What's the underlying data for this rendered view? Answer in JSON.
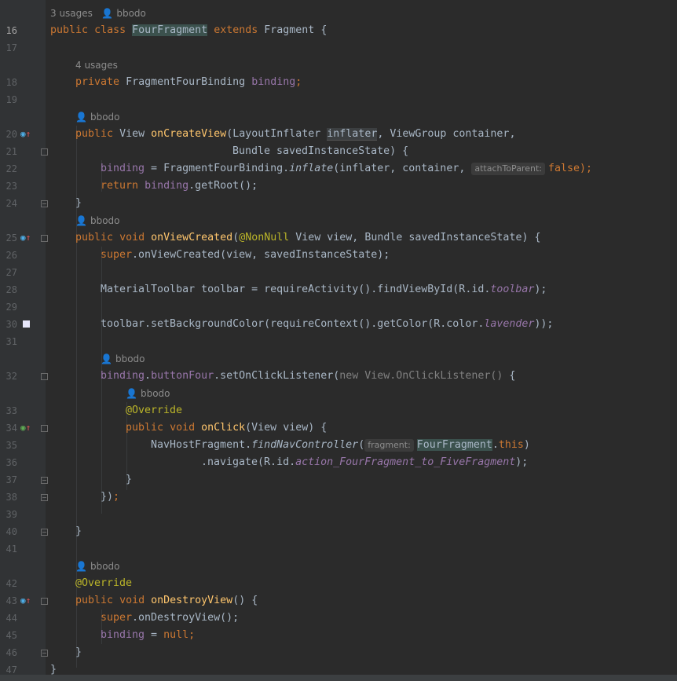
{
  "editor": {
    "hints": {
      "usages3": "3 usages",
      "usages4": "4 usages",
      "author": "bbodo"
    },
    "lines": {
      "l16": {
        "num": "16",
        "kw1": "public",
        "kw2": "class",
        "cls": "FourFragment",
        "kw3": "extends",
        "rest": "Fragment {"
      },
      "l17": {
        "num": "17"
      },
      "l18": {
        "num": "18",
        "kw": "private",
        "type": "FragmentFourBinding",
        "field": "binding",
        "semi": ";"
      },
      "l19": {
        "num": "19"
      },
      "l20": {
        "num": "20",
        "kw": "public",
        "type": "View",
        "fn": "onCreateView",
        "open": "(LayoutInflater ",
        "param": "inflater",
        "rest": ", ViewGroup container,"
      },
      "l21": {
        "num": "21",
        "text": "Bundle savedInstanceState) {"
      },
      "l22": {
        "num": "22",
        "field": "binding",
        "eq": " = FragmentFourBinding.",
        "m": "inflate",
        "args": "(inflater, container, ",
        "inlay": "attachToParent:",
        "kwv": "false",
        "end": ");"
      },
      "l23": {
        "num": "23",
        "kw": "return",
        "field": "binding",
        "rest": ".getRoot();"
      },
      "l24": {
        "num": "24",
        "text": "}"
      },
      "l25": {
        "num": "25",
        "kw1": "public",
        "kw2": "void",
        "fn": "onViewCreated",
        "open": "(",
        "an": "@NonNull",
        "rest": " View view, Bundle savedInstanceState) {"
      },
      "l26": {
        "num": "26",
        "kw": "super",
        "rest": ".onViewCreated(view, savedInstanceState);"
      },
      "l27": {
        "num": "27"
      },
      "l28": {
        "num": "28",
        "pre": "MaterialToolbar toolbar = requireActivity().findViewById(R.id.",
        "field": "toolbar",
        "end": ");"
      },
      "l29": {
        "num": "29"
      },
      "l30": {
        "num": "30",
        "pre": "toolbar.setBackgroundColor(requireContext().getColor(R.color.",
        "field": "lavender",
        "end": "));"
      },
      "l31": {
        "num": "31"
      },
      "l32": {
        "num": "32",
        "field": "binding",
        "dot": ".",
        "field2": "buttonFour",
        "mid": ".setOnClickListener(",
        "grey": "new View.OnClickListener()",
        "end": " {"
      },
      "l33": {
        "num": "33",
        "an": "@Override"
      },
      "l34": {
        "num": "34",
        "kw1": "public",
        "kw2": "void",
        "fn": "onClick",
        "rest": "(View view) {"
      },
      "l35": {
        "num": "35",
        "pre": "NavHostFragment.",
        "m": "findNavController",
        "open": "(",
        "inlay": "fragment:",
        "cls": "FourFragment",
        "dot": ".",
        "kw": "this",
        "end": ")"
      },
      "l36": {
        "num": "36",
        "pre": ".navigate(R.id.",
        "field": "action_FourFragment_to_FiveFragment",
        "end": ");"
      },
      "l37": {
        "num": "37",
        "text": "}"
      },
      "l38": {
        "num": "38",
        "text": "})",
        "semi": ";"
      },
      "l39": {
        "num": "39"
      },
      "l40": {
        "num": "40",
        "text": "}"
      },
      "l41": {
        "num": "41"
      },
      "l42": {
        "num": "42",
        "an": "@Override"
      },
      "l43": {
        "num": "43",
        "kw1": "public",
        "kw2": "void",
        "fn": "onDestroyView",
        "rest": "() {"
      },
      "l44": {
        "num": "44",
        "kw": "super",
        "rest": ".onDestroyView();"
      },
      "l45": {
        "num": "45",
        "field": "binding",
        "eq": " = ",
        "kw": "null",
        "semi": ";"
      },
      "l46": {
        "num": "46",
        "text": "}"
      },
      "l47": {
        "num": "47",
        "text": "}"
      }
    },
    "colors": {
      "background": "#2b2b2b",
      "keyword": "#cc7832",
      "method": "#ffc66d",
      "annotation": "#bbb529",
      "field": "#9876aa",
      "lavender_swatch": "#e6e6fa"
    }
  }
}
